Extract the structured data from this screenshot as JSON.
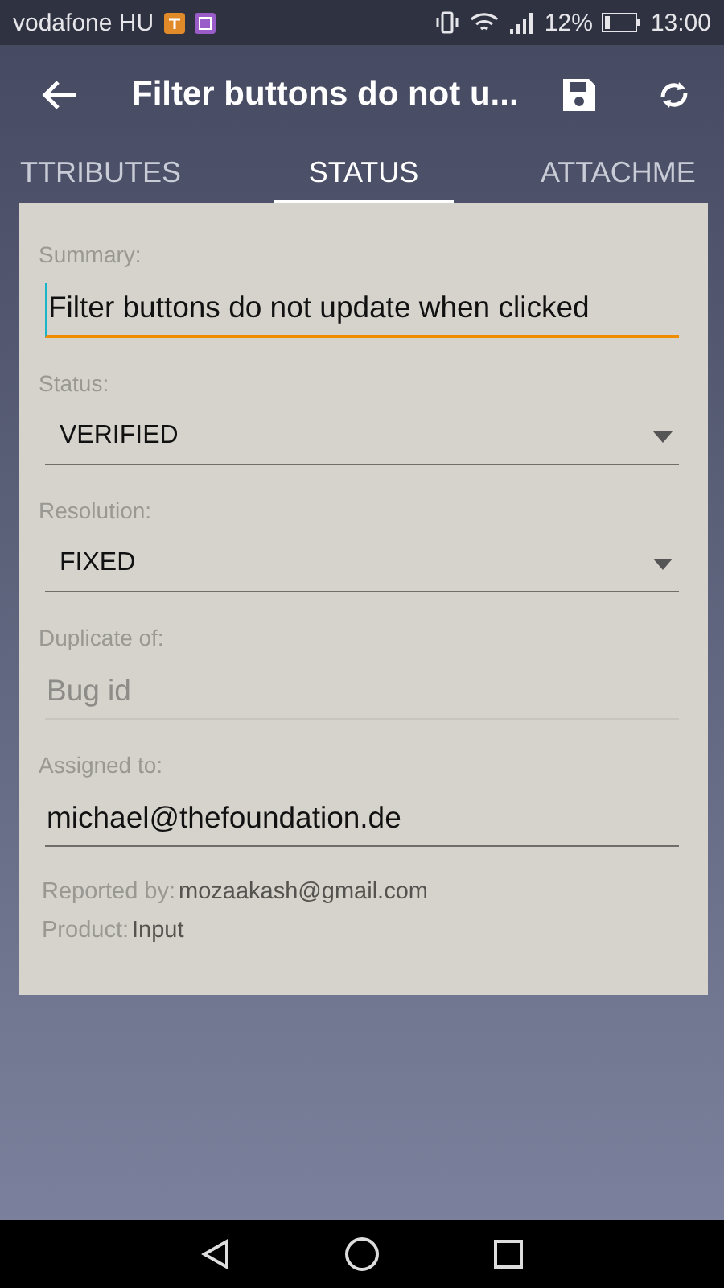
{
  "status_bar": {
    "carrier": "vodafone HU",
    "battery": "12%",
    "time": "13:00"
  },
  "app_bar": {
    "title": "Filter buttons do not u..."
  },
  "tabs": [
    {
      "label": "TTRIBUTES",
      "selected": false
    },
    {
      "label": "STATUS",
      "selected": true
    },
    {
      "label": "ATTACHME",
      "selected": false
    }
  ],
  "fields": [
    {
      "kind": "text",
      "label": "Summary:",
      "value": "Filter buttons do not update when clicked",
      "focused": true
    },
    {
      "kind": "select",
      "label": "Status:",
      "value": "VERIFIED"
    },
    {
      "kind": "select",
      "label": "Resolution:",
      "value": "FIXED"
    },
    {
      "kind": "text",
      "label": "Duplicate of:",
      "placeholder": "Bug id",
      "focused": false
    },
    {
      "kind": "text",
      "label": "Assigned to:",
      "value": "michael@thefoundation.de",
      "focused": false
    }
  ],
  "info": [
    {
      "label": "Reported by:",
      "value": "mozaakash@gmail.com"
    },
    {
      "label": "Product:",
      "value": "Input"
    }
  ]
}
